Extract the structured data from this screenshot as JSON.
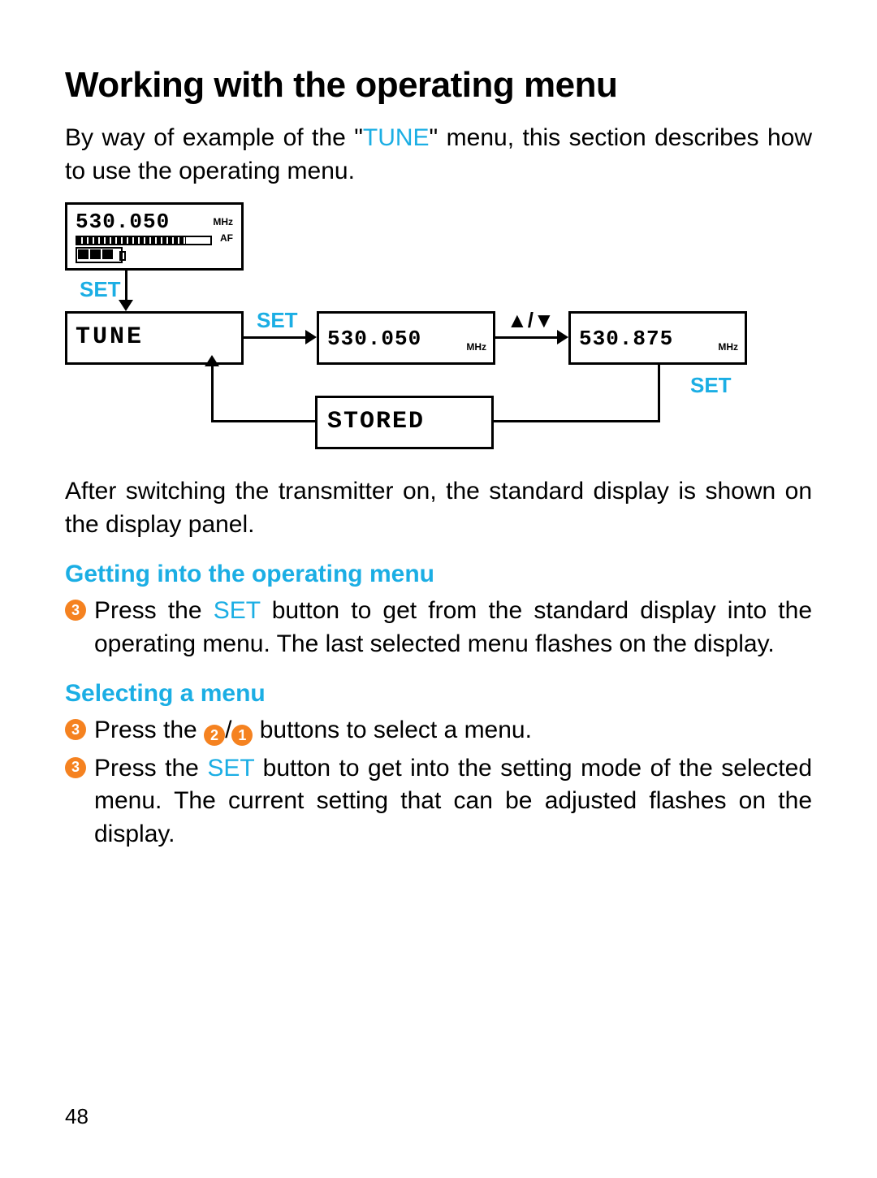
{
  "title": "Working with the operating menu",
  "intro_pre": "By way of example of the \"",
  "intro_tune": "TUNE",
  "intro_post": "\" menu, this section describes how to use the operating menu.",
  "after_diagram": "After switching the transmitter on, the standard display is shown on the display panel.",
  "section1": {
    "heading": "Getting into the operating menu",
    "step_badge": "3",
    "step_pre": "Press the ",
    "step_set": "SET",
    "step_post": " button to get from the standard display into the operating menu. The last selected menu flashes on the display."
  },
  "section2": {
    "heading": "Selecting a menu",
    "step1_badge": "3",
    "step1_pre": "Press the ",
    "step1_b2": "2",
    "step1_slash": "/",
    "step1_b1": "1",
    "step1_post": " buttons to select a menu.",
    "step2_badge": "3",
    "step2_pre": "Press the ",
    "step2_set": "SET",
    "step2_post": " button to get into the setting mode of the selected menu. The current setting that can be adjusted flashes on the display."
  },
  "diagram": {
    "top_freq": "530.050",
    "top_unit": "MHz",
    "af_label": "AF",
    "set_label": "SET",
    "tune_label": "TUNE",
    "freq1": "530.050",
    "freq1_unit": "MHz",
    "updown": "▲/▼",
    "freq2": "530.875",
    "freq2_unit": "MHz",
    "stored": "STORED"
  },
  "page_number": "48"
}
